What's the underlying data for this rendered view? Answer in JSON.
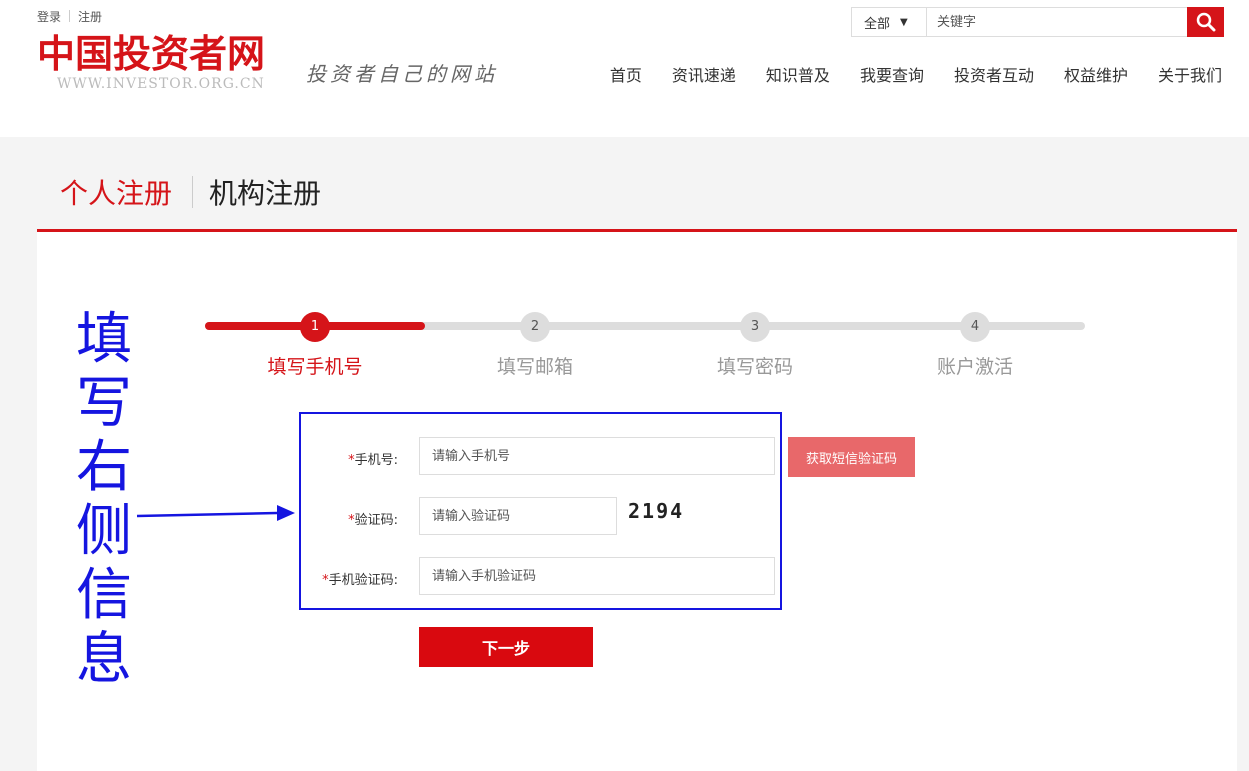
{
  "top_links": {
    "login": "登录",
    "register": "注册"
  },
  "logo": {
    "name": "中国投资者网",
    "url": "WWW.INVESTOR.ORG.CN"
  },
  "slogan": "投资者自己的网站",
  "search": {
    "category": "全部",
    "placeholder": "关键字"
  },
  "nav": [
    "首页",
    "资讯速递",
    "知识普及",
    "我要查询",
    "投资者互动",
    "权益维护",
    "关于我们"
  ],
  "reg_tabs": {
    "personal": "个人注册",
    "org": "机构注册"
  },
  "annotation": "填写右侧信息",
  "steps": [
    {
      "num": "1",
      "label": "填写手机号",
      "active": true
    },
    {
      "num": "2",
      "label": "填写邮箱",
      "active": false
    },
    {
      "num": "3",
      "label": "填写密码",
      "active": false
    },
    {
      "num": "4",
      "label": "账户激活",
      "active": false
    }
  ],
  "progress": {
    "completed_fraction": 0.25
  },
  "form": {
    "required_mark": "*",
    "phone_label": "手机号:",
    "phone_placeholder": "请输入手机号",
    "sms_button": "获取短信验证码",
    "captcha_label": "验证码:",
    "captcha_placeholder": "请输入验证码",
    "captcha_value": "2194",
    "sms_code_label": "手机验证码:",
    "sms_code_placeholder": "请输入手机验证码",
    "next_button": "下一步"
  },
  "colors": {
    "brand_red": "#d51419",
    "annotation_blue": "#1515e0"
  }
}
